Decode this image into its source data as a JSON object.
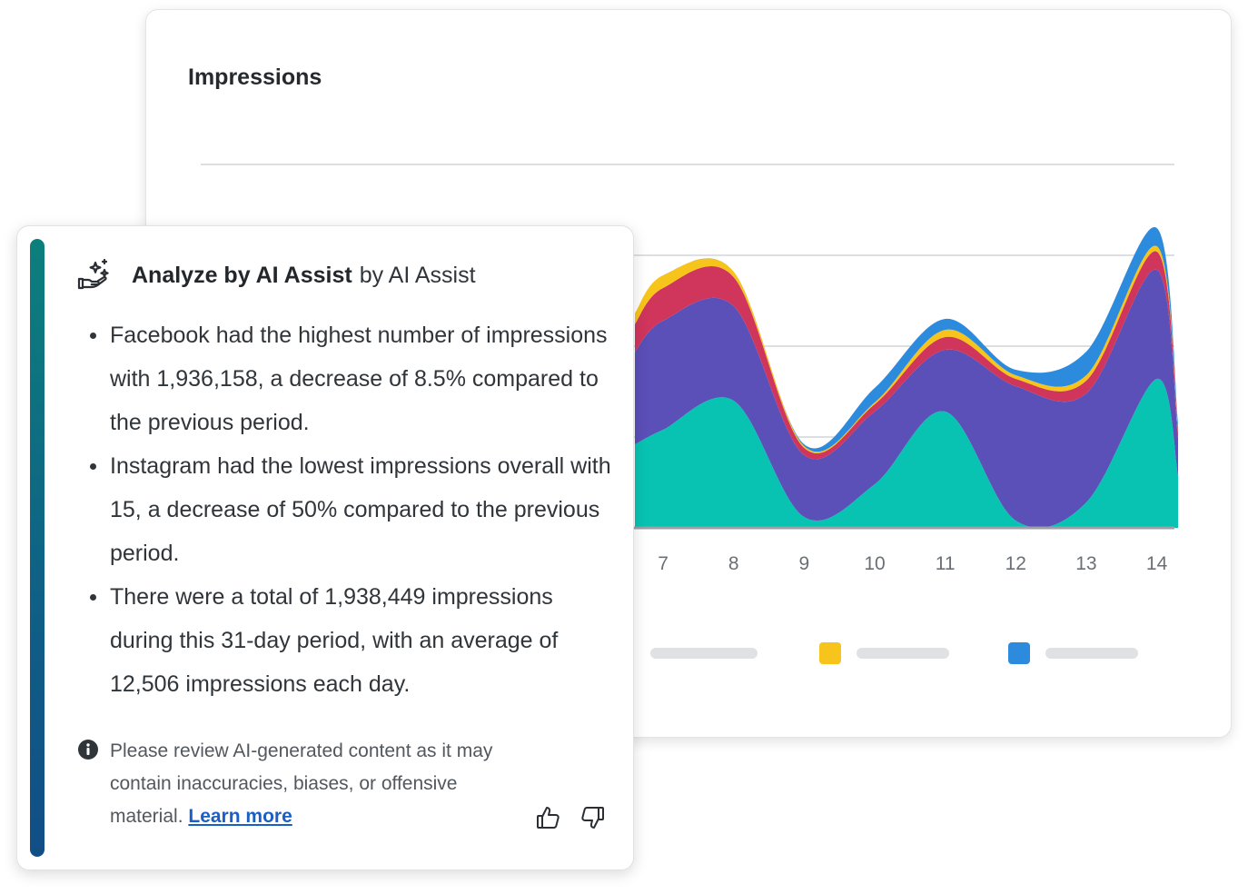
{
  "chart": {
    "title": "Impressions",
    "colors": {
      "teal": "#08c3b2",
      "purple": "#5b4fb8",
      "red": "#d0355c",
      "yellow": "#f6c41a",
      "blue": "#2d8bde",
      "grid": "#d2d5d8",
      "legend_bar": "#dfe2e4"
    }
  },
  "chart_data": {
    "type": "area",
    "stacked": true,
    "title": "Impressions",
    "x": [
      7,
      8,
      9,
      10,
      11,
      12,
      13,
      14
    ],
    "visible_x_range": [
      6.6,
      14.25
    ],
    "series": [
      {
        "color": "#08c3b2",
        "values": [
          54,
          70,
          6,
          24,
          64,
          4,
          14,
          82
        ]
      },
      {
        "color": "#5b4fb8",
        "values": [
          60,
          52,
          34,
          40,
          34,
          74,
          60,
          60
        ]
      },
      {
        "color": "#d0355c",
        "values": [
          18,
          16,
          4,
          4,
          7,
          4,
          7,
          10
        ]
      },
      {
        "color": "#f6c41a",
        "values": [
          7,
          3,
          1,
          1,
          4,
          2,
          3,
          3
        ]
      },
      {
        "color": "#2d8bde",
        "values": [
          0,
          0,
          1,
          8,
          6,
          3,
          13,
          10
        ]
      }
    ],
    "ylim": [
      0,
      200
    ],
    "grid": true,
    "gridline_values": [
      50,
      100,
      150,
      200
    ],
    "legend": {
      "placement": "bottom",
      "swatch_colors": [
        "#f6c41a",
        "#2d8bde"
      ]
    }
  },
  "ai": {
    "title": "Analyze by AI Assist",
    "by": "by AI Assist",
    "bullets": [
      "Facebook had the highest number of impressions with 1,936,158, a decrease of 8.5% compared to the previous period.",
      "Instagram had the lowest impressions overall with 15, a decrease of 50% compared to the previous period.",
      "There were a total of 1,938,449 impressions during this 31-day period, with an average of 12,506 impressions each day."
    ],
    "disclaimer": "Please review AI-generated content as it may contain inaccuracies, biases, or offensive material.",
    "learn_more": "Learn more",
    "icons": {
      "header": "hand-sparkle-icon",
      "info": "info-icon",
      "like": "thumbs-up-icon",
      "dislike": "thumbs-down-icon"
    }
  }
}
